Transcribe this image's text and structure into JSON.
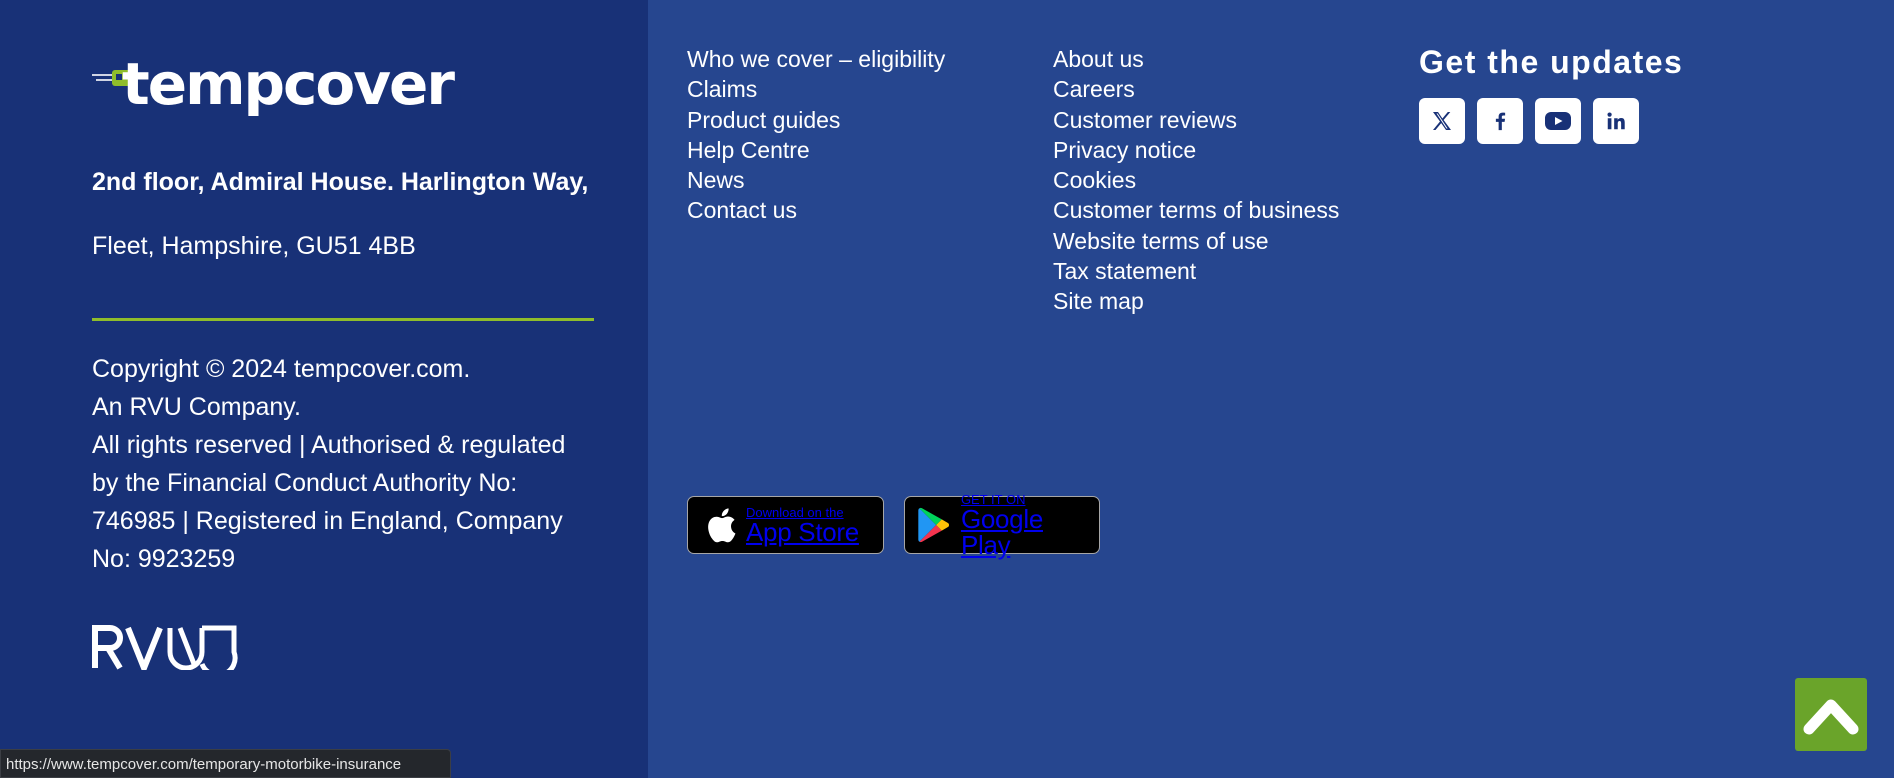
{
  "brand": {
    "logo_text": "tempcover",
    "colors": {
      "left_panel": "#183177",
      "right_panel": "#26468f",
      "accent_green": "#8fbd2b",
      "scroll_green": "#6aa42a"
    }
  },
  "address": {
    "line1": "2nd floor, Admiral House. Harlington Way,",
    "line2": "Fleet, Hampshire, GU51 4BB"
  },
  "copyright": {
    "lines": [
      "Copyright © 2024 tempcover.com.",
      "An RVU Company.",
      "All rights reserved | Authorised & regulated",
      "by the Financial Conduct Authority No:",
      "746985 | Registered in England, Company",
      "No: 9923259"
    ]
  },
  "rvu_logo": {
    "alt": "RVU"
  },
  "nav_col_1": [
    "Who we cover – eligibility",
    "Claims",
    "Product guides",
    "Help Centre",
    "News",
    "Contact us"
  ],
  "nav_col_2": [
    "About us",
    "Careers",
    "Customer reviews",
    "Privacy notice",
    "Cookies",
    "Customer terms of business",
    "Website terms of use",
    "Tax statement",
    "Site map"
  ],
  "updates": {
    "title": "Get the updates",
    "social": [
      "x-icon",
      "facebook-icon",
      "youtube-icon",
      "linkedin-icon"
    ]
  },
  "app_store": {
    "small": "Download on the",
    "big": "App Store",
    "icon": "apple-icon"
  },
  "google_play": {
    "small": "GET IT ON",
    "big": "Google Play",
    "icon": "google-play-icon"
  },
  "scroll_top": {
    "icon": "chevron-up-icon"
  },
  "status_bar": {
    "url": "https://www.tempcover.com/temporary-motorbike-insurance"
  }
}
